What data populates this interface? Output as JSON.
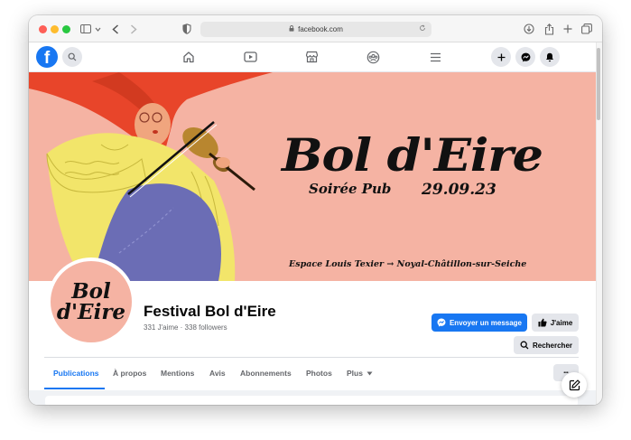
{
  "browser": {
    "url": "facebook.com"
  },
  "fb_nav": {
    "logo_letter": "f"
  },
  "cover": {
    "title": "Bol d'Eire",
    "subtitle": "Soirée Pub",
    "date": "29.09.23",
    "venue": "Espace Louis Texier → Noyal-Châtillon-sur-Seiche"
  },
  "profile": {
    "avatar_line1": "Bol",
    "avatar_line2": "d'Eire",
    "name": "Festival Bol d'Eire",
    "stats": "331 J'aime · 338 followers"
  },
  "actions": {
    "message_label": "Envoyer un message",
    "like_label": "J'aime",
    "search_label": "Rechercher"
  },
  "tabs": [
    {
      "label": "Publications"
    },
    {
      "label": "À propos"
    },
    {
      "label": "Mentions"
    },
    {
      "label": "Avis"
    },
    {
      "label": "Abonnements"
    },
    {
      "label": "Photos"
    },
    {
      "label": "Plus"
    }
  ],
  "more_label": "•••",
  "colors": {
    "brand": "#1877f2",
    "cover_bg": "#f5b3a3"
  }
}
